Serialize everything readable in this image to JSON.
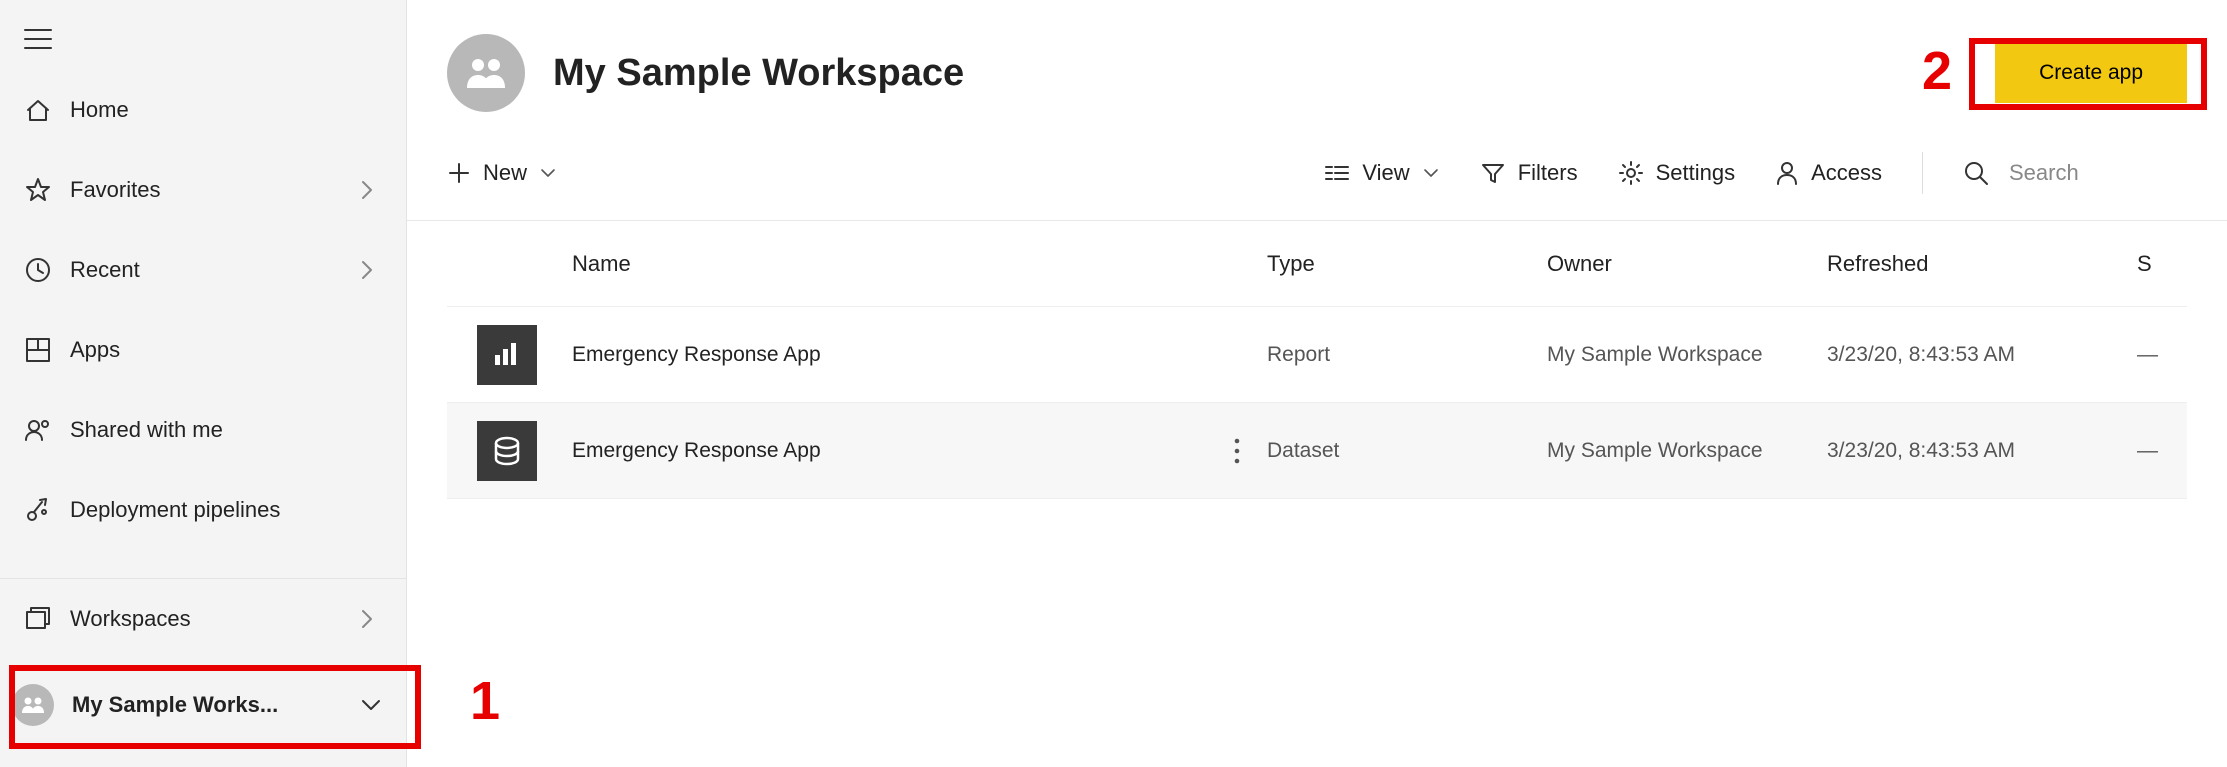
{
  "sidebar": {
    "items": [
      {
        "label": "Home",
        "icon": "home-icon",
        "chevron": false
      },
      {
        "label": "Favorites",
        "icon": "star-icon",
        "chevron": true
      },
      {
        "label": "Recent",
        "icon": "clock-icon",
        "chevron": true
      },
      {
        "label": "Apps",
        "icon": "apps-icon",
        "chevron": false
      },
      {
        "label": "Shared with me",
        "icon": "shared-icon",
        "chevron": false
      },
      {
        "label": "Deployment pipelines",
        "icon": "pipeline-icon",
        "chevron": false
      }
    ],
    "workspaces_label": "Workspaces",
    "current_workspace_short": "My Sample Works..."
  },
  "header": {
    "title": "My Sample Workspace",
    "create_app_label": "Create app"
  },
  "toolbar": {
    "new_label": "New",
    "view_label": "View",
    "filters_label": "Filters",
    "settings_label": "Settings",
    "access_label": "Access",
    "search_placeholder": "Search"
  },
  "table": {
    "columns": {
      "name": "Name",
      "type": "Type",
      "owner": "Owner",
      "refreshed": "Refreshed",
      "sensitivity": "S"
    },
    "rows": [
      {
        "icon": "report-icon",
        "name": "Emergency Response App",
        "type": "Report",
        "owner": "My Sample Workspace",
        "refreshed": "3/23/20, 8:43:53 AM",
        "sensitivity": "—",
        "show_menu": false,
        "alt": false
      },
      {
        "icon": "dataset-icon",
        "name": "Emergency Response App",
        "type": "Dataset",
        "owner": "My Sample Workspace",
        "refreshed": "3/23/20, 8:43:53 AM",
        "sensitivity": "—",
        "show_menu": true,
        "alt": true
      }
    ]
  },
  "annotations": {
    "one": "1",
    "two": "2"
  }
}
